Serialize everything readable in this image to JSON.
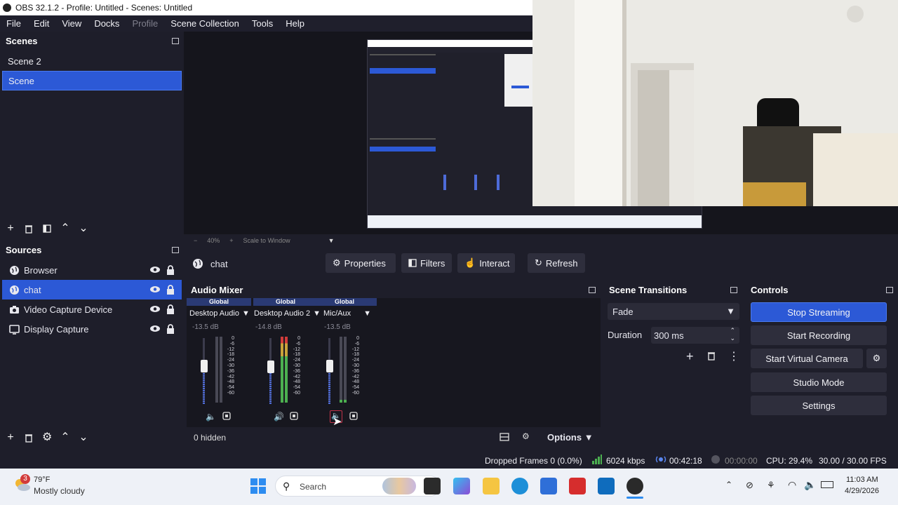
{
  "window": {
    "title": "OBS 32.1.2 - Profile: Untitled - Scenes: Untitled"
  },
  "menu": [
    "File",
    "Edit",
    "View",
    "Docks",
    "Profile",
    "Scene Collection",
    "Tools",
    "Help"
  ],
  "scenes": {
    "title": "Scenes",
    "items": [
      {
        "label": "Scene 2",
        "selected": false
      },
      {
        "label": "Scene",
        "selected": true
      }
    ]
  },
  "sources": {
    "title": "Sources",
    "items": [
      {
        "label": "Browser",
        "icon": "globe-icon",
        "selected": false
      },
      {
        "label": "chat",
        "icon": "globe-icon",
        "selected": true
      },
      {
        "label": "Video Capture Device",
        "icon": "camera-icon",
        "selected": false
      },
      {
        "label": "Display Capture",
        "icon": "monitor-icon",
        "selected": false
      }
    ]
  },
  "zoom": {
    "minus": "−",
    "level": "40%",
    "plus": "+",
    "mode": "Scale to Window"
  },
  "source_toolbar": {
    "name": "chat",
    "properties": "Properties",
    "filters": "Filters",
    "interact": "Interact",
    "refresh": "Refresh"
  },
  "mixer": {
    "title": "Audio Mixer",
    "channels": [
      {
        "scope": "Global",
        "name": "Desktop Audio",
        "db": "-13.5 dB",
        "level": 0.5,
        "muted": true
      },
      {
        "scope": "Global",
        "name": "Desktop Audio 2",
        "db": "-14.8 dB",
        "level": 0.49,
        "muted": false
      },
      {
        "scope": "Global",
        "name": "Mic/Aux",
        "db": "-13.5 dB",
        "level": 0.5,
        "muted": true
      }
    ],
    "scale": [
      "0",
      "-6",
      "-12",
      "-18",
      "-24",
      "-30",
      "-36",
      "-42",
      "-48",
      "-54",
      "-60"
    ],
    "hidden": "0 hidden",
    "options": "Options"
  },
  "transitions": {
    "title": "Scene Transitions",
    "selected": "Fade",
    "duration_label": "Duration",
    "duration_value": "300 ms"
  },
  "controls": {
    "title": "Controls",
    "stop_streaming": "Stop Streaming",
    "start_recording": "Start Recording",
    "start_virtual_camera": "Start Virtual Camera",
    "studio_mode": "Studio Mode",
    "settings": "Settings"
  },
  "status": {
    "dropped": "Dropped Frames 0 (0.0%)",
    "bitrate": "6024 kbps",
    "stream_time": "00:42:18",
    "rec_time": "00:00:00",
    "cpu": "CPU: 29.4%",
    "fps": "30.00 / 30.00 FPS"
  },
  "taskbar": {
    "weather_badge": "3",
    "temp": "79°F",
    "condition": "Mostly cloudy",
    "search": "Search",
    "time": "11:03 AM",
    "date": "4/29/2026"
  },
  "colors": {
    "accent": "#2c59d6",
    "panel": "#1e1e2a",
    "meter_green": "#4caf50",
    "meter_red": "#d23b3b"
  }
}
